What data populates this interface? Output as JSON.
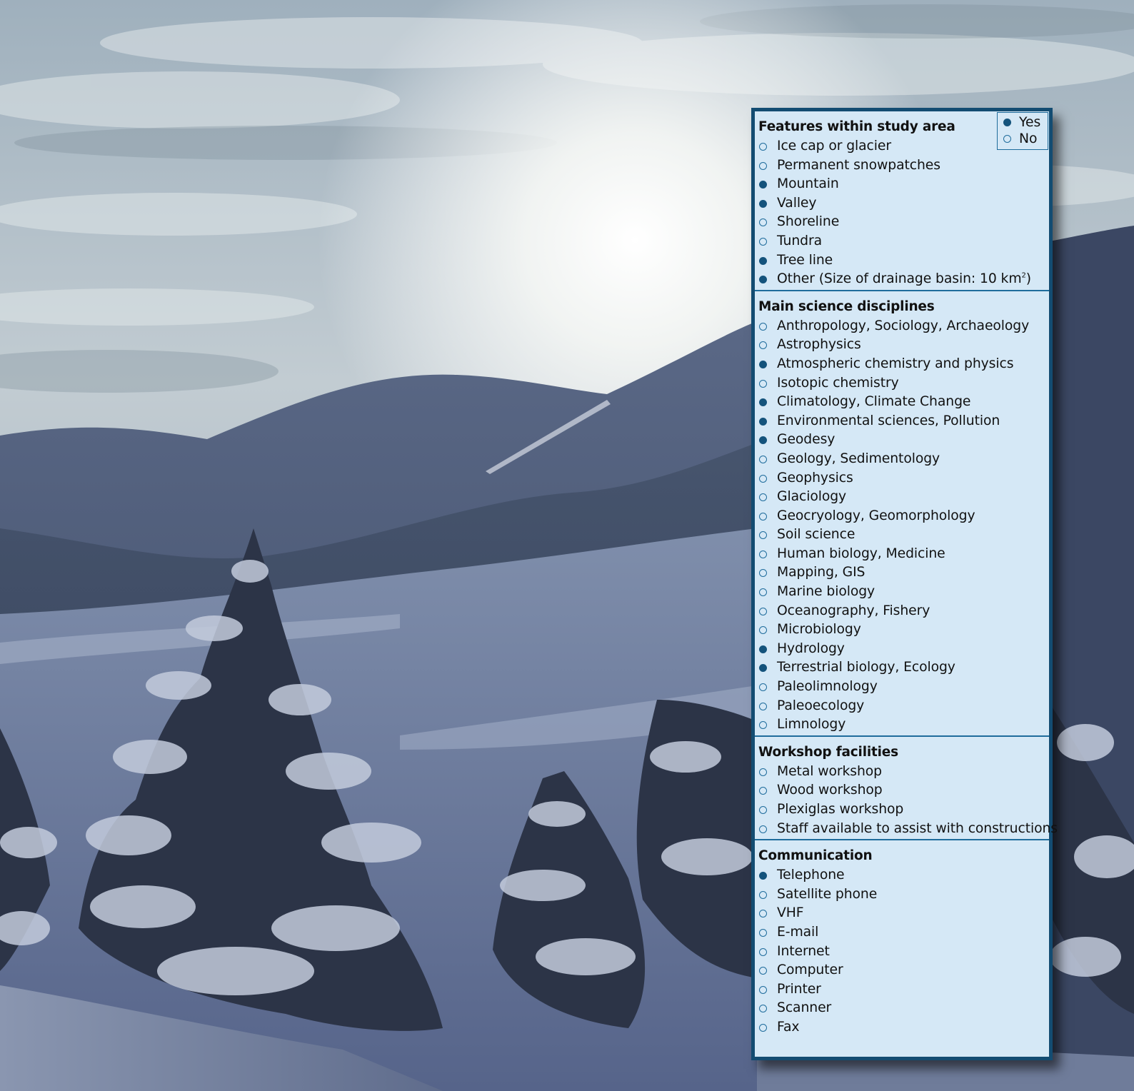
{
  "background": {
    "description_icon": "snowy-mountain-landscape-photo",
    "sky_color": "#b7c3cc",
    "snow_color": "#6a7b98"
  },
  "legend": {
    "yes_label": "Yes",
    "no_label": "No"
  },
  "sections": [
    {
      "title": "Features within study area",
      "items": [
        {
          "label": "Ice cap or glacier",
          "value": "no"
        },
        {
          "label": "Permanent snowpatches",
          "value": "no"
        },
        {
          "label": "Mountain",
          "value": "yes"
        },
        {
          "label": "Valley",
          "value": "yes"
        },
        {
          "label": "Shoreline",
          "value": "no"
        },
        {
          "label": "Tundra",
          "value": "no"
        },
        {
          "label": "Tree line",
          "value": "yes"
        },
        {
          "label": "Other (Size of drainage basin: 10 km",
          "sup": "2",
          "suffix": ")",
          "value": "yes"
        }
      ]
    },
    {
      "title": "Main science disciplines",
      "items": [
        {
          "label": "Anthropology, Sociology, Archaeology",
          "value": "no"
        },
        {
          "label": "Astrophysics",
          "value": "no"
        },
        {
          "label": "Atmospheric chemistry and physics",
          "value": "yes"
        },
        {
          "label": "Isotopic chemistry",
          "value": "no"
        },
        {
          "label": "Climatology, Climate Change",
          "value": "yes"
        },
        {
          "label": "Environmental sciences, Pollution",
          "value": "yes"
        },
        {
          "label": "Geodesy",
          "value": "yes"
        },
        {
          "label": "Geology, Sedimentology",
          "value": "no"
        },
        {
          "label": "Geophysics",
          "value": "no"
        },
        {
          "label": "Glaciology",
          "value": "no"
        },
        {
          "label": "Geocryology, Geomorphology",
          "value": "no"
        },
        {
          "label": "Soil science",
          "value": "no"
        },
        {
          "label": "Human biology, Medicine",
          "value": "no"
        },
        {
          "label": "Mapping, GIS",
          "value": "no"
        },
        {
          "label": "Marine biology",
          "value": "no"
        },
        {
          "label": "Oceanography, Fishery",
          "value": "no"
        },
        {
          "label": "Microbiology",
          "value": "no"
        },
        {
          "label": "Hydrology",
          "value": "yes"
        },
        {
          "label": "Terrestrial biology, Ecology",
          "value": "yes"
        },
        {
          "label": "Paleolimnology",
          "value": "no"
        },
        {
          "label": "Paleoecology",
          "value": "no"
        },
        {
          "label": "Limnology",
          "value": "no"
        }
      ]
    },
    {
      "title": "Workshop facilities",
      "items": [
        {
          "label": "Metal workshop",
          "value": "no"
        },
        {
          "label": "Wood workshop",
          "value": "no"
        },
        {
          "label": "Plexiglas workshop",
          "value": "no"
        },
        {
          "label": "Staff available to assist with constructions",
          "value": "no"
        }
      ]
    },
    {
      "title": "Communication",
      "items": [
        {
          "label": "Telephone",
          "value": "yes"
        },
        {
          "label": "Satellite phone",
          "value": "no"
        },
        {
          "label": "VHF",
          "value": "no"
        },
        {
          "label": "E-mail",
          "value": "no"
        },
        {
          "label": "Internet",
          "value": "no"
        },
        {
          "label": "Computer",
          "value": "no"
        },
        {
          "label": "Printer",
          "value": "no"
        },
        {
          "label": "Scanner",
          "value": "no"
        },
        {
          "label": "Fax",
          "value": "no"
        }
      ]
    }
  ]
}
